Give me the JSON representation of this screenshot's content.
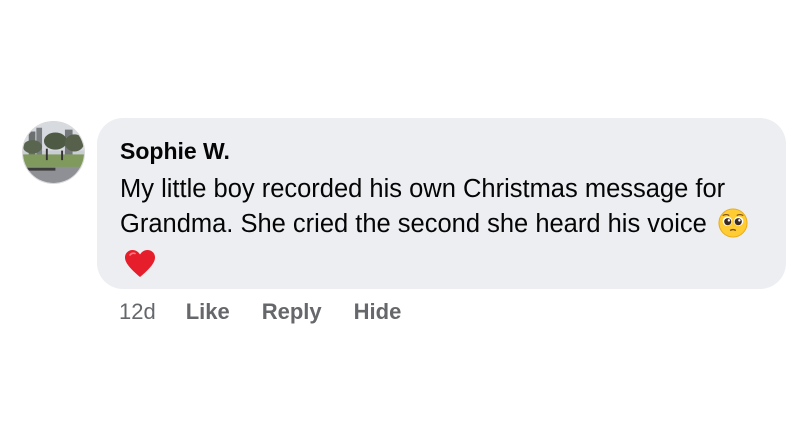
{
  "comment": {
    "author": "Sophie W.",
    "text": "My little boy recorded his own Christmas message for Grandma. She cried the second she heard his voice",
    "emojis": [
      "pleading-face-emoji",
      "red-heart-emoji"
    ],
    "avatar": "profile-photo-park-scene"
  },
  "actions": {
    "timestamp": "12d",
    "like_label": "Like",
    "reply_label": "Reply",
    "hide_label": "Hide"
  },
  "colors": {
    "bubble_background": "#eceef2",
    "text_primary": "#050505",
    "text_secondary": "#65676b"
  }
}
